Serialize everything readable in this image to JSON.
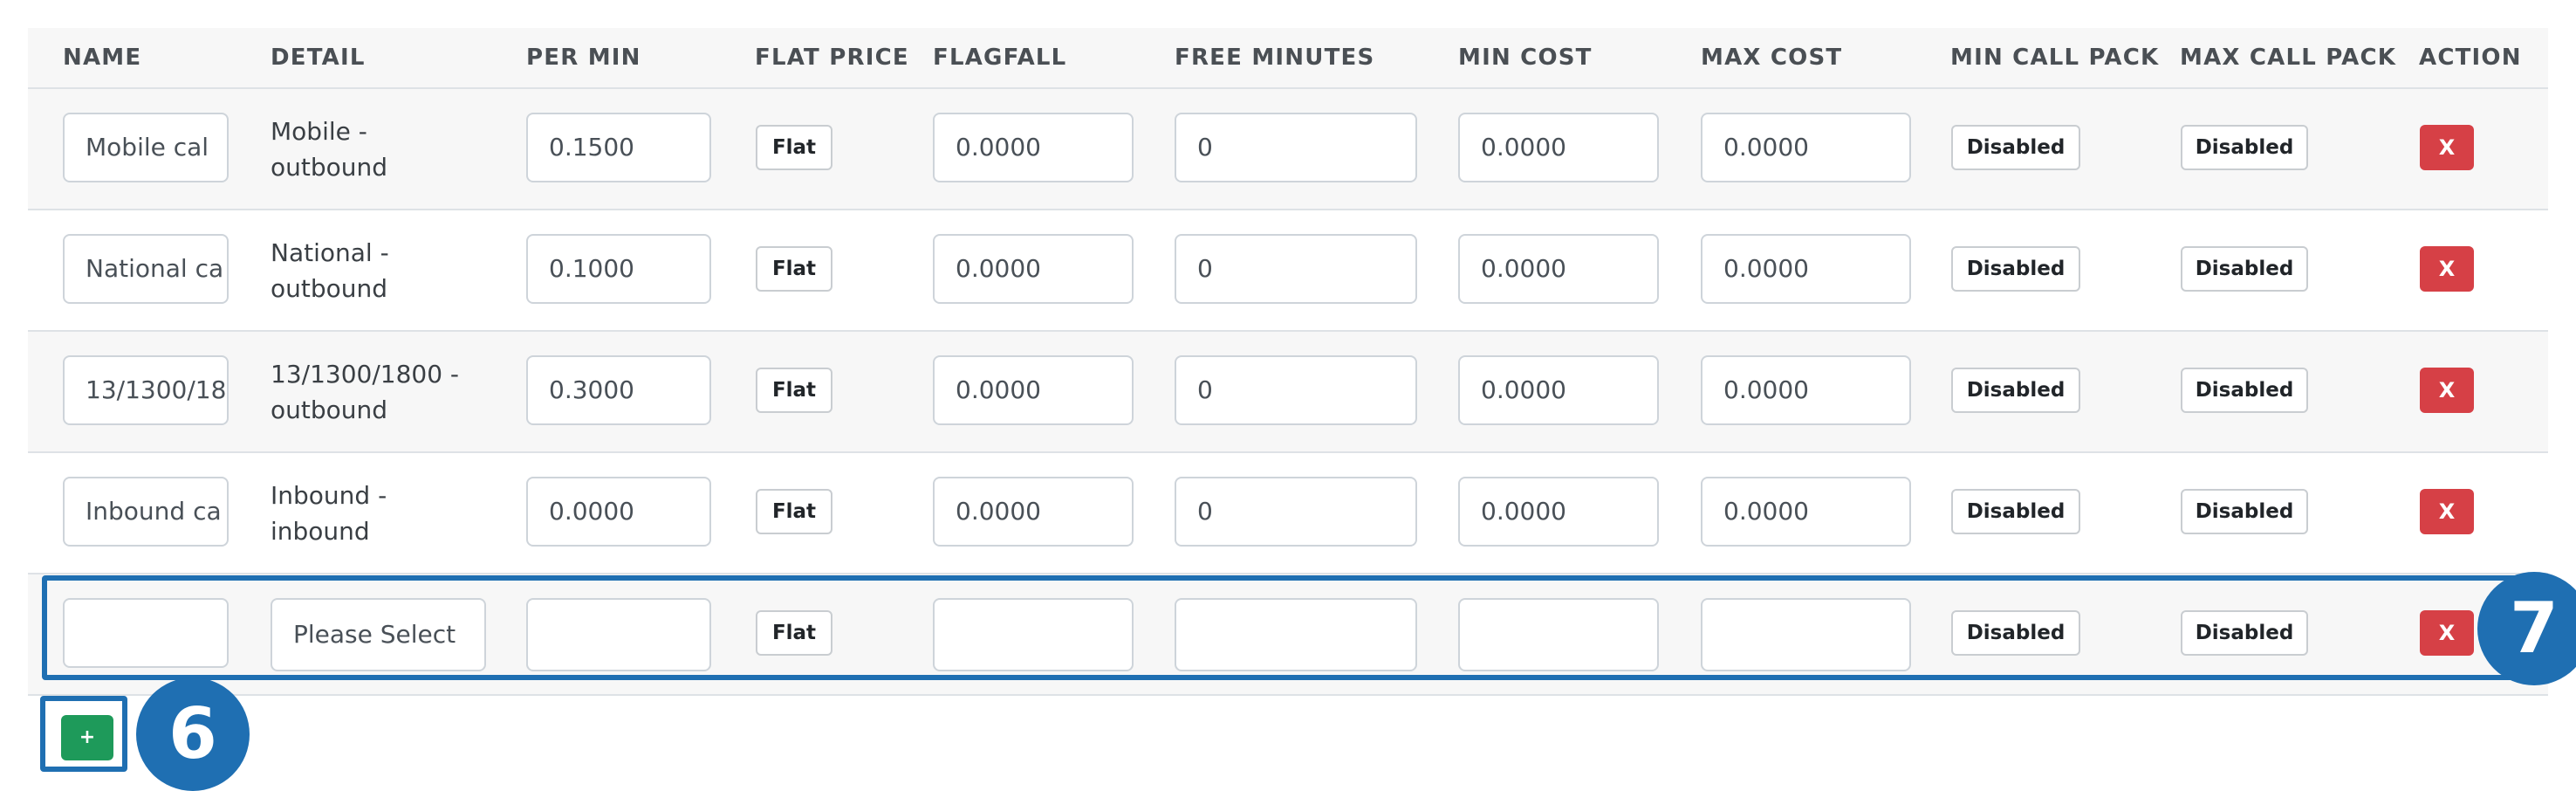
{
  "headers": {
    "name": "NAME",
    "detail": "DETAIL",
    "per_min": "PER MIN",
    "flat_price": "FLAT PRICE",
    "flagfall": "FLAGFALL",
    "free_minutes": "FREE MINUTES",
    "min_cost": "MIN COST",
    "max_cost": "MAX COST",
    "min_call_pack": "MIN CALL PACK",
    "max_call_pack": "MAX CALL PACK",
    "action": "ACTION"
  },
  "rows": [
    {
      "name": "Mobile cal",
      "detail_line1": "Mobile -",
      "detail_line2": "outbound",
      "per_min": "0.1500",
      "flat": "Flat",
      "flagfall": "0.0000",
      "free_minutes": "0",
      "min_cost": "0.0000",
      "max_cost": "0.0000",
      "min_call_pack": "Disabled",
      "max_call_pack": "Disabled",
      "delete": "X"
    },
    {
      "name": "National ca",
      "detail_line1": "National -",
      "detail_line2": "outbound",
      "per_min": "0.1000",
      "flat": "Flat",
      "flagfall": "0.0000",
      "free_minutes": "0",
      "min_cost": "0.0000",
      "max_cost": "0.0000",
      "min_call_pack": "Disabled",
      "max_call_pack": "Disabled",
      "delete": "X"
    },
    {
      "name": "13/1300/18",
      "detail_line1": "13/1300/1800 -",
      "detail_line2": "outbound",
      "per_min": "0.3000",
      "flat": "Flat",
      "flagfall": "0.0000",
      "free_minutes": "0",
      "min_cost": "0.0000",
      "max_cost": "0.0000",
      "min_call_pack": "Disabled",
      "max_call_pack": "Disabled",
      "delete": "X"
    },
    {
      "name": "Inbound ca",
      "detail_line1": "Inbound -",
      "detail_line2": "inbound",
      "per_min": "0.0000",
      "flat": "Flat",
      "flagfall": "0.0000",
      "free_minutes": "0",
      "min_cost": "0.0000",
      "max_cost": "0.0000",
      "min_call_pack": "Disabled",
      "max_call_pack": "Disabled",
      "delete": "X"
    }
  ],
  "new_row": {
    "name": "",
    "detail_select": "Please Select",
    "per_min": "",
    "flat": "Flat",
    "flagfall": "",
    "free_minutes": "",
    "min_cost": "",
    "max_cost": "",
    "min_call_pack": "Disabled",
    "max_call_pack": "Disabled",
    "delete": "X"
  },
  "add_button": "+",
  "callouts": {
    "add_button_number": "6",
    "new_row_number": "7"
  },
  "colors": {
    "highlight": "#1f6fb2",
    "delete": "#d64046",
    "add": "#1e9a5a"
  }
}
